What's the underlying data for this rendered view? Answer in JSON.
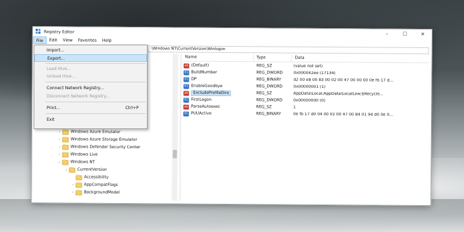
{
  "window": {
    "title": "Registry Editor",
    "controls": [
      "–",
      "☐",
      "✕"
    ]
  },
  "menu": {
    "items": [
      "File",
      "Edit",
      "View",
      "Favorites",
      "Help"
    ]
  },
  "address": {
    "path": "\\Windows NT\\CurrentVersion\\Winlogon"
  },
  "file_menu": {
    "import": "Import...",
    "export": "Export...",
    "load_hive": "Load Hive...",
    "unload_hive": "Unload Hive...",
    "connect": "Connect Network Registry...",
    "disconnect": "Disconnect Network Registry...",
    "print": "Print...",
    "print_shortcut": "Ctrl+P",
    "exit": "Exit"
  },
  "tree": {
    "items": [
      {
        "label": "Windows Azure Emulator"
      },
      {
        "label": "Windows Azure Storage Emulator"
      },
      {
        "label": "Windows Defender Security Center"
      },
      {
        "label": "Windows Live"
      },
      {
        "label": "Windows NT"
      },
      {
        "label": "CurrentVersion"
      },
      {
        "label": "Accessibility"
      },
      {
        "label": "AppCompatFlags"
      },
      {
        "label": "BackgroundModel"
      }
    ]
  },
  "list": {
    "headers": {
      "name": "Name",
      "type": "Type",
      "data": "Data"
    },
    "rows": [
      {
        "name": "(Default)",
        "type": "REG_SZ",
        "data": "(value not set)",
        "icon": "ab"
      },
      {
        "name": "BuildNumber",
        "type": "REG_DWORD",
        "data": "0x000042ee (17134)",
        "icon": "bin"
      },
      {
        "name": "DP",
        "type": "REG_BINARY",
        "data": "d2 00 e8 00 83 00 02 00 47 00 00 00 0e fb 17 d...",
        "icon": "bin"
      },
      {
        "name": "EnableGoodbye",
        "type": "REG_DWORD",
        "data": "0x00000001 (1)",
        "icon": "bin"
      },
      {
        "name": "ExcludeProfileDirs",
        "type": "REG_SZ",
        "data": "AppData\\Local;AppData\\LocalLow;$Recycle...",
        "icon": "ab"
      },
      {
        "name": "FirstLogon",
        "type": "REG_DWORD",
        "data": "0x00000000 (0)",
        "icon": "bin"
      },
      {
        "name": "ParseAutoexec",
        "type": "REG_SZ",
        "data": "1",
        "icon": "ab"
      },
      {
        "name": "PUUActive",
        "type": "REG_BINARY",
        "data": "0e fb 17 d0 04 00 02 00 47 00 84 01 94 d0 0e 0...",
        "icon": "bin"
      }
    ]
  },
  "colors": {
    "selection": "#cce4f7",
    "selection_border": "#99c9ef",
    "folder": "#f4d06f"
  }
}
